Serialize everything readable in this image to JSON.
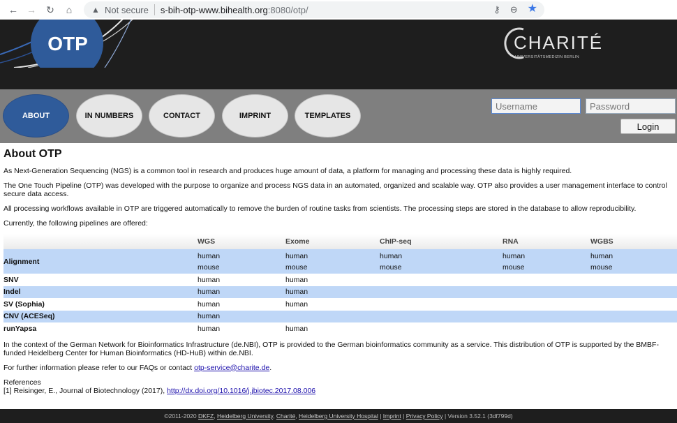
{
  "browser": {
    "security": "Not secure",
    "url_host": "s-bih-otp-www.bihealth.org",
    "url_path": ":8080/otp/"
  },
  "header": {
    "logo_text": "OTP",
    "partner_name": "CHARITÉ",
    "partner_sub": "UNIVERSITÄTSMEDIZIN BERLIN"
  },
  "nav": {
    "items": [
      {
        "label": "ABOUT",
        "active": true
      },
      {
        "label": "IN NUMBERS",
        "active": false
      },
      {
        "label": "CONTACT",
        "active": false
      },
      {
        "label": "IMPRINT",
        "active": false
      },
      {
        "label": "TEMPLATES",
        "active": false
      }
    ],
    "username_placeholder": "Username",
    "password_placeholder": "Password",
    "login_label": "Login"
  },
  "main": {
    "title": "About OTP",
    "paragraphs": [
      "As Next-Generation Sequencing (NGS) is a common tool in research and produces huge amount of data, a platform for managing and processing these data is highly required.",
      "The One Touch Pipeline (OTP) was developed with the purpose to organize and process NGS data in an automated, organized and scalable way. OTP also provides a user management interface to control secure data access.",
      "All processing workflows available in OTP are triggered automatically to remove the burden of routine tasks from scientists. The processing steps are stored in the database to allow reproducibility.",
      "Currently, the following pipelines are offered:"
    ],
    "table": {
      "headers": [
        "",
        "WGS",
        "Exome",
        "ChIP-seq",
        "RNA",
        "WGBS"
      ],
      "rows": [
        {
          "name": "Alignment",
          "cells": [
            "human\nmouse",
            "human\nmouse",
            "human\nmouse",
            "human\nmouse",
            "human\nmouse"
          ]
        },
        {
          "name": "SNV",
          "cells": [
            "human",
            "human",
            "",
            "",
            ""
          ]
        },
        {
          "name": "Indel",
          "cells": [
            "human",
            "human",
            "",
            "",
            ""
          ]
        },
        {
          "name": "SV (Sophia)",
          "cells": [
            "human",
            "human",
            "",
            "",
            ""
          ]
        },
        {
          "name": "CNV (ACESeq)",
          "cells": [
            "human",
            "",
            "",
            "",
            ""
          ]
        },
        {
          "name": "runYapsa",
          "cells": [
            "human",
            "human",
            "",
            "",
            ""
          ]
        }
      ]
    },
    "after_paragraph": "In the context of the German Network for Bioinformatics Infrastructure (de.NBI), OTP is provided to the German bioinformatics community as a service. This distribution of OTP is supported by the BMBF-funded Heidelberg Center for Human Bioinformatics (HD-HuB) within de.NBI.",
    "contact_prefix": "For further information please refer to our FAQs or contact ",
    "contact_email": "otp-service@charite.de",
    "contact_suffix": ".",
    "references_label": "References",
    "reference_prefix": "[1] Reisinger, E., Journal of Biotechnology (2017), ",
    "reference_link": "http://dx.doi.org/10.1016/j.jbiotec.2017.08.006"
  },
  "footer": {
    "copyright": "©2011-2020 ",
    "links": [
      "DKFZ",
      "Heidelberg University",
      "Charité",
      "Heidelberg University Hospital"
    ],
    "imprint": "Imprint",
    "privacy": "Privacy Policy",
    "version": " | Version 3.52.1 (3df799d)"
  },
  "colors": {
    "accent": "#2f5b9a",
    "header_bg": "#1e1e1e",
    "nav_bg": "#7f7f7f",
    "row_highlight": "#bfd7f7"
  }
}
